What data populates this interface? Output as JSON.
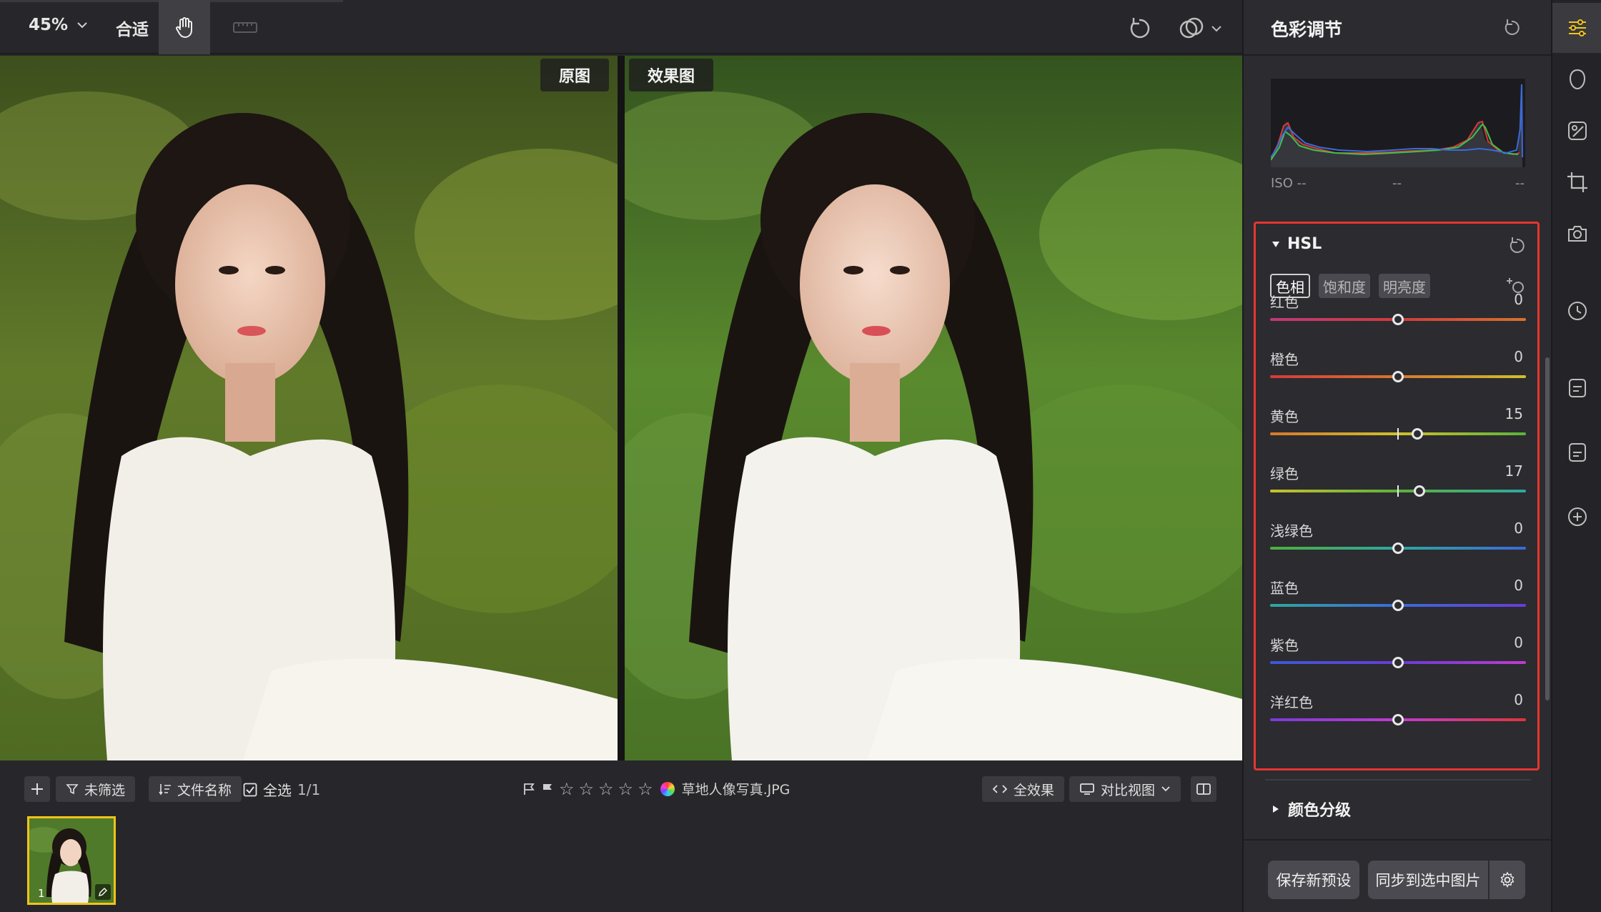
{
  "toolbar": {
    "zoom_value": "45%",
    "fit_label": "合适",
    "icons": [
      "chevron-down-icon",
      "hand-icon",
      "ruler-icon",
      "undo-icon",
      "compare-overlay-icon"
    ]
  },
  "viewer": {
    "before_label": "原图",
    "after_label": "效果图"
  },
  "bottombar": {
    "filter_label": "未筛选",
    "sort_label": "文件名称",
    "select_all_label": "全选",
    "select_count": "1/1",
    "file_name": "草地人像写真.JPG",
    "effect_label": "全效果",
    "view_mode_label": "对比视图",
    "star_count": 5
  },
  "filmstrip": {
    "thumb_number": "1"
  },
  "panel": {
    "title": "色彩调节",
    "exif": {
      "iso": "ISO --",
      "mid": "--",
      "right": "--"
    },
    "hsl": {
      "title": "HSL",
      "tabs": [
        {
          "label": "色相",
          "active": true
        },
        {
          "label": "饱和度",
          "active": false
        },
        {
          "label": "明亮度",
          "active": false
        }
      ],
      "sliders": [
        {
          "label": "红色",
          "value": 0,
          "gradient": "linear-gradient(90deg,#c0397a,#d13c3c,#d8722d)"
        },
        {
          "label": "橙色",
          "value": 0,
          "gradient": "linear-gradient(90deg,#d43a3a,#d8782d,#cfc02b)"
        },
        {
          "label": "黄色",
          "value": 15,
          "gradient": "linear-gradient(90deg,#d8782d,#cfc02b,#5bb33a)"
        },
        {
          "label": "绿色",
          "value": 17,
          "gradient": "linear-gradient(90deg,#c9c02b,#5bb33a,#2fa7a0)"
        },
        {
          "label": "浅绿色",
          "value": 0,
          "gradient": "linear-gradient(90deg,#4eaf3c,#2fa7a0,#3b6ad8)"
        },
        {
          "label": "蓝色",
          "value": 0,
          "gradient": "linear-gradient(90deg,#2fa7a0,#3b6ad8,#6a3bd8)"
        },
        {
          "label": "紫色",
          "value": 0,
          "gradient": "linear-gradient(90deg,#3b5ad8,#6a3bd8,#c13bd0)"
        },
        {
          "label": "洋红色",
          "value": 0,
          "gradient": "linear-gradient(90deg,#7a3bd8,#c33bd0,#e0353a)"
        }
      ]
    },
    "grading_label": "颜色分级",
    "save_preset_label": "保存新预设",
    "sync_label": "同步到选中图片"
  },
  "rail": {
    "icons": [
      "color-adjust-icon",
      "face-icon",
      "retouch-icon",
      "crop-icon",
      "camera-icon",
      "history-icon",
      "preset-list-icon",
      "note-icon",
      "add-icon"
    ]
  },
  "colors": {
    "accent_highlight": "#e5362f",
    "thumb_border": "#f0c419",
    "background": "#27272b"
  }
}
